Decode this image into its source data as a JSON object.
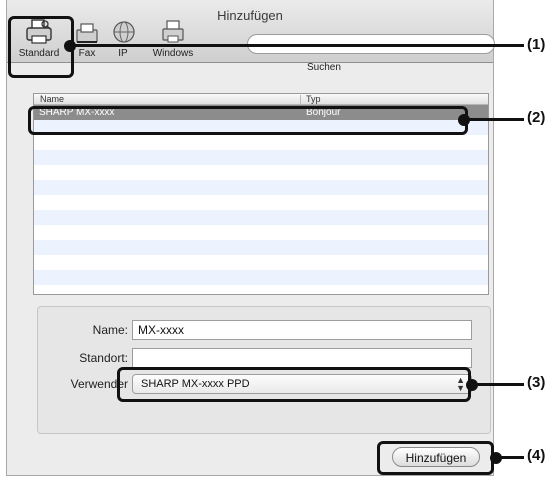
{
  "window": {
    "title": "Hinzufügen"
  },
  "toolbar": {
    "items": [
      {
        "label": "Standard",
        "icon": "printer-icon"
      },
      {
        "label": "Fax",
        "icon": "fax-icon"
      },
      {
        "label": "IP",
        "icon": "globe-icon"
      },
      {
        "label": "Windows",
        "icon": "windows-printer-icon"
      }
    ],
    "search_label": "Suchen"
  },
  "printer_list": {
    "columns": [
      "Name",
      "Typ"
    ],
    "rows": [
      {
        "name": "SHARP MX-xxxx",
        "type": "Bonjour",
        "selected": true
      }
    ]
  },
  "form": {
    "name_label": "Name:",
    "name_value": "MX-xxxx",
    "location_label": "Standort:",
    "location_value": "",
    "driver_label": "Verwender",
    "driver_value": "SHARP MX-xxxx PPD"
  },
  "add_button_label": "Hinzufügen",
  "callouts": [
    "(1)",
    "(2)",
    "(3)",
    "(4)"
  ]
}
